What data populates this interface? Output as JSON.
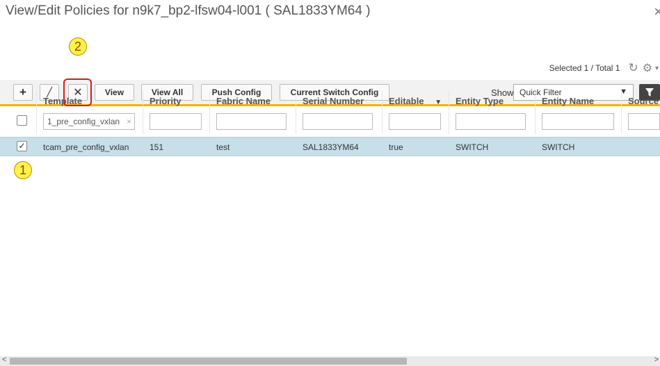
{
  "dialog": {
    "title": "View/Edit Policies for n9k7_bp2-lfsw04-l001 ( SAL1833YM64 )",
    "close_glyph": "×"
  },
  "status": {
    "selection": "Selected 1 / Total 1",
    "refresh_icon": "refresh-icon",
    "settings_icon": "gear-icon"
  },
  "toolbar": {
    "add_glyph": "+",
    "edit_glyph": "╱",
    "delete_glyph": "✕",
    "view_label": "View",
    "view_all_label": "View All",
    "push_config_label": "Push Config",
    "current_switch_config_label": "Current Switch Config",
    "show_label": "Show",
    "filter_value": "Quick Filter",
    "filter_caret": "▼",
    "filter_glyph": "▼"
  },
  "table": {
    "columns": [
      "Template",
      "Priority",
      "Fabric Name",
      "Serial Number",
      "Editable",
      "Entity Type",
      "Entity Name",
      "Source"
    ],
    "editable_sort_glyph": "▼",
    "filters": {
      "template": "1_pre_config_vxlan"
    },
    "clear_glyph": "×",
    "rows": [
      {
        "checked": true,
        "template": "tcam_pre_config_vxlan",
        "priority": "151",
        "fabric_name": "test",
        "serial_number": "SAL1833YM64",
        "editable": "true",
        "entity_type": "SWITCH",
        "entity_name": "SWITCH",
        "source": ""
      }
    ]
  },
  "annotations": {
    "marker_1": "1",
    "marker_2": "2",
    "marker_color": "#fff24a",
    "highlight_color": "#d61c1c"
  },
  "colors": {
    "accent_bar": "#f0b400",
    "selected_row": "#c6dfe8"
  }
}
